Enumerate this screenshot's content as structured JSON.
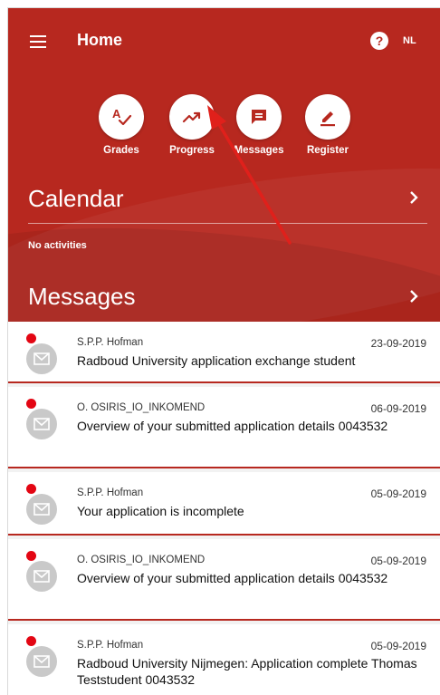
{
  "header": {
    "title": "Home",
    "help_symbol": "?",
    "language": "NL"
  },
  "shortcuts": [
    {
      "label": "Grades",
      "icon": "spellcheck-icon"
    },
    {
      "label": "Progress",
      "icon": "trending-up-icon"
    },
    {
      "label": "Messages",
      "icon": "message-icon"
    },
    {
      "label": "Register",
      "icon": "edit-icon"
    }
  ],
  "calendar": {
    "title": "Calendar",
    "empty_text": "No activities"
  },
  "messages_section": {
    "title": "Messages"
  },
  "messages": [
    {
      "sender": "S.P.P. Hofman",
      "date": "23-09-2019",
      "subject": "Radboud University application exchange student"
    },
    {
      "sender": "O. OSIRIS_IO_INKOMEND",
      "date": "06-09-2019",
      "subject": "Overview of your submitted application details 0043532"
    },
    {
      "sender": "S.P.P. Hofman",
      "date": "05-09-2019",
      "subject": "Your application is incomplete"
    },
    {
      "sender": "O. OSIRIS_IO_INKOMEND",
      "date": "05-09-2019",
      "subject": "Overview of your submitted application details 0043532"
    },
    {
      "sender": "S.P.P. Hofman",
      "date": "05-09-2019",
      "subject": "Radboud University Nijmegen: Application complete Thomas Teststudent 0043532"
    }
  ],
  "colors": {
    "brand": "#b7281f",
    "unread_dot": "#e30613",
    "annotation_arrow": "#e0201b"
  }
}
